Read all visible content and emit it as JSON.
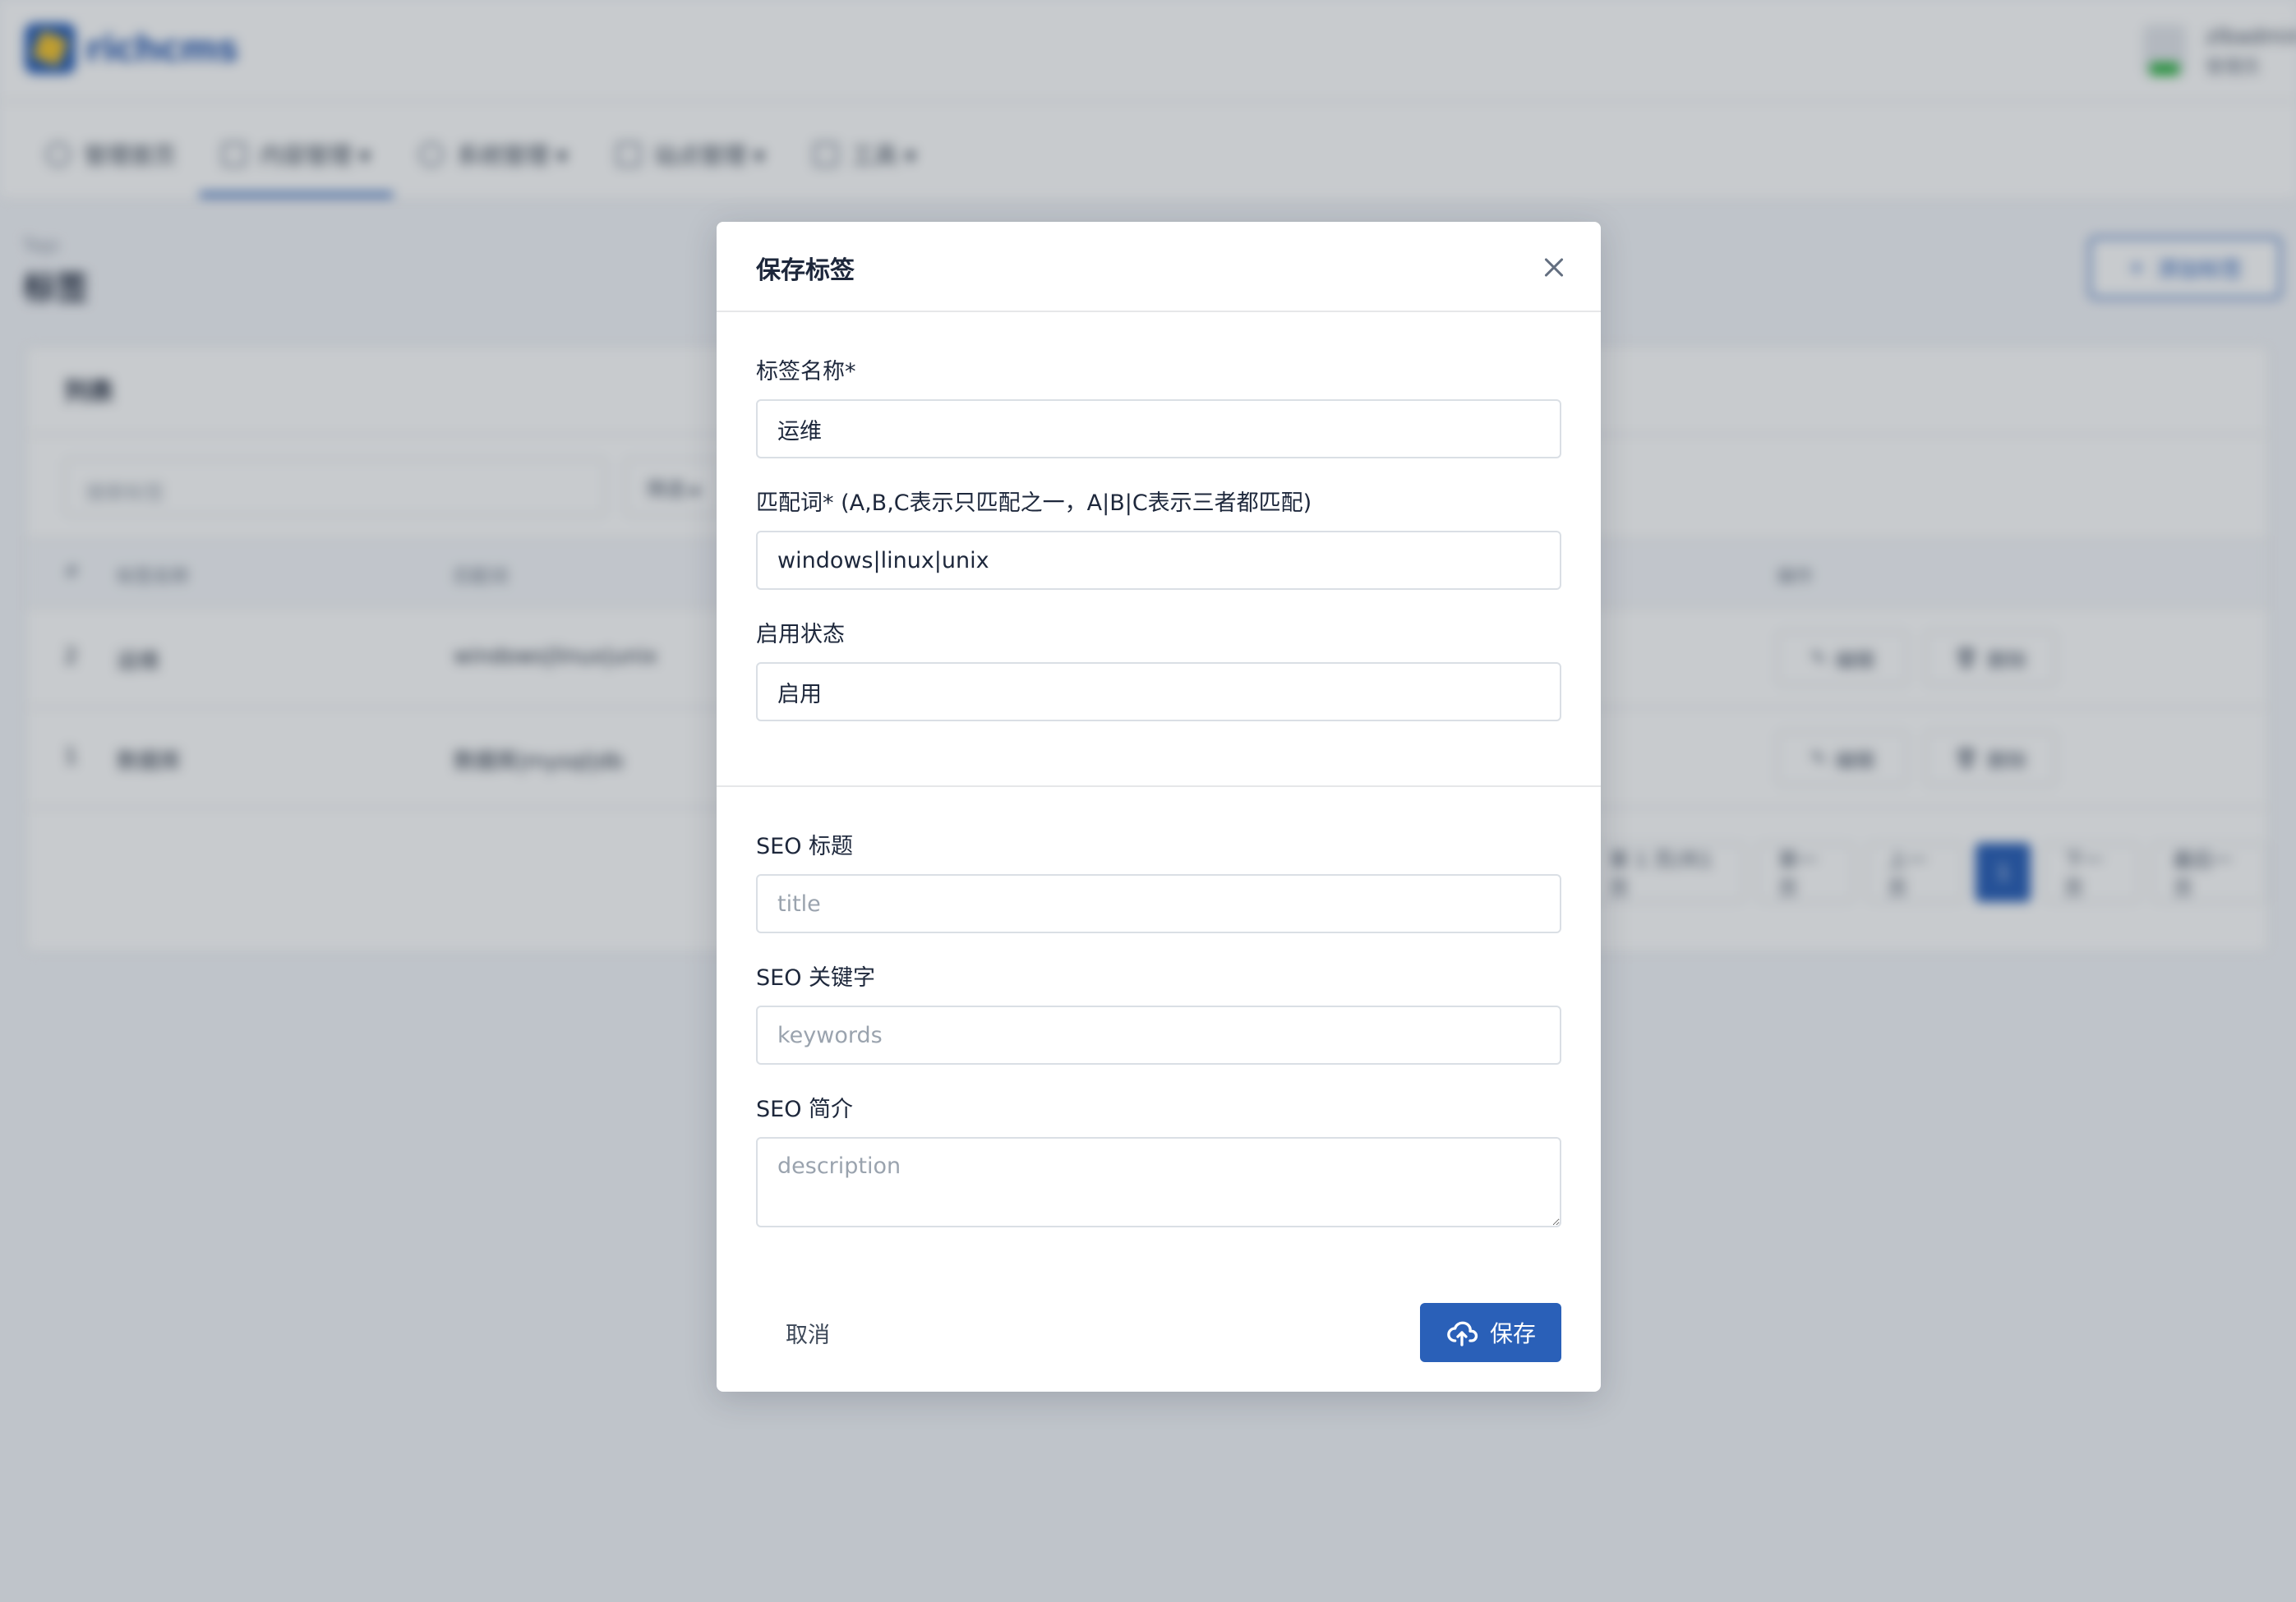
{
  "app": {
    "logo_text": "richcms",
    "user": {
      "name": "zlbadmin",
      "role": "管理员"
    }
  },
  "nav": {
    "items": [
      {
        "label": "管理首页"
      },
      {
        "label": "内容管理 ▾"
      },
      {
        "label": "系统管理 ▾"
      },
      {
        "label": "站点管理 ▾"
      },
      {
        "label": "工具 ▾"
      }
    ]
  },
  "page": {
    "pretitle": "Tags",
    "title": "标签",
    "add_button": "添加标签"
  },
  "list_card": {
    "title": "列表",
    "search_placeholder": "搜索标签",
    "filter_button": "筛选 ▸",
    "columns": [
      "#",
      "标签名称",
      "匹配词",
      "操作"
    ],
    "rows": [
      {
        "id": "2",
        "name": "运维",
        "keywords": "windows|linux|unix",
        "edit": "编辑",
        "delete": "删除"
      },
      {
        "id": "1",
        "name": "数据库",
        "keywords": "数据库|mysql|db",
        "edit": "编辑",
        "delete": "删除"
      }
    ],
    "pager": [
      "第 1 页/共1页",
      "第一页",
      "上一页",
      "1",
      "下一页",
      "最后一页"
    ]
  },
  "modal": {
    "title": "保存标签",
    "fields": {
      "name": {
        "label": "标签名称*",
        "value": "运维"
      },
      "keywords": {
        "label": "匹配词* (A,B,C表示只匹配之一，A|B|C表示三者都匹配)",
        "value": "windows|linux|unix"
      },
      "status": {
        "label": "启用状态",
        "value": "启用"
      },
      "seo_title": {
        "label": "SEO 标题",
        "placeholder": "title"
      },
      "seo_keywords": {
        "label": "SEO 关键字",
        "placeholder": "keywords"
      },
      "seo_description": {
        "label": "SEO 简介",
        "placeholder": "description"
      }
    },
    "cancel_label": "取消",
    "save_label": "保存"
  },
  "colors": {
    "primary": "#2a60b8",
    "backdrop": "rgba(24,36,51,0.24)"
  }
}
